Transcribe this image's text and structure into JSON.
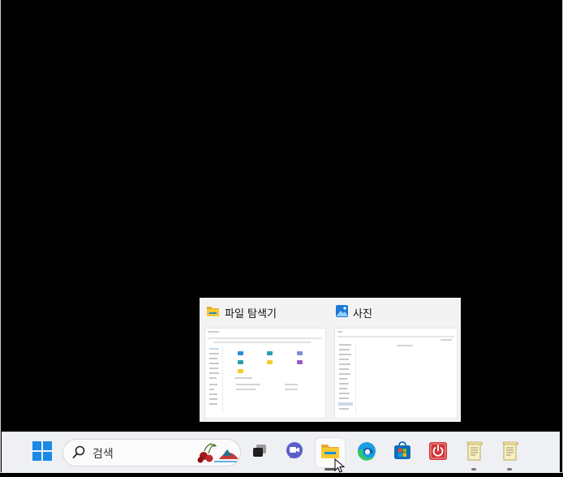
{
  "thumbnails": [
    {
      "title": "파일 탐색기",
      "icon": "file-explorer-icon"
    },
    {
      "title": "사진",
      "icon": "photos-icon"
    }
  ],
  "taskbar": {
    "search_placeholder": "검색",
    "items": [
      "start-icon",
      "search",
      "task-view-icon",
      "teams-chat-icon",
      "file-explorer-icon",
      "edge-icon",
      "microsoft-store-icon",
      "power-app-icon",
      "notepad-icon",
      "notepad-icon"
    ]
  },
  "colors": {
    "accent": "#0f6cbd",
    "taskbar": "#eef0f3",
    "folder": "#f9c82f"
  }
}
